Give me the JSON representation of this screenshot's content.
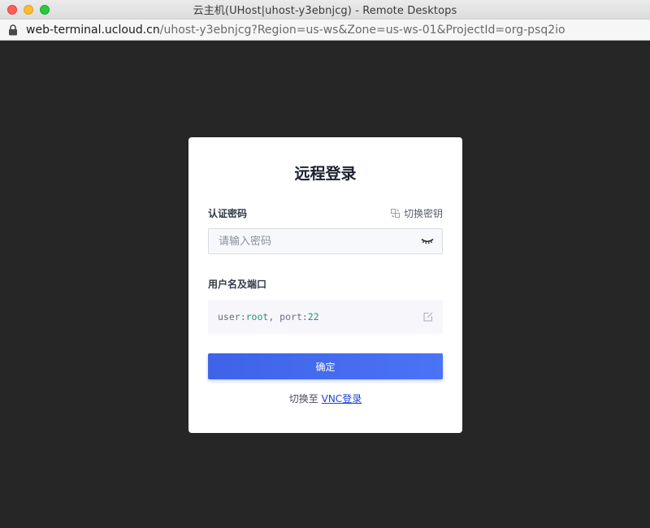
{
  "window": {
    "title": "云主机(UHost|uhost-y3ebnjcg) - Remote Desktops"
  },
  "address": {
    "host": "web-terminal.ucloud.cn",
    "path": "/uhost-y3ebnjcg?Region=us-ws&Zone=us-ws-01&ProjectId=org-psq2io"
  },
  "login": {
    "title": "远程登录",
    "password_label": "认证密码",
    "switch_key_label": "切换密钥",
    "password_placeholder": "请输入密码",
    "user_port_label": "用户名及端口",
    "user_key": "user:",
    "user_value": "root",
    "port_key": ", port:",
    "port_value": "22",
    "confirm_label": "确定",
    "switch_prefix": "切换至 ",
    "vnc_link": "VNC登录"
  },
  "colors": {
    "accent": "#3e63e8",
    "value_green": "#1a9a6c",
    "link": "#1a44d8",
    "background": "#262626"
  }
}
